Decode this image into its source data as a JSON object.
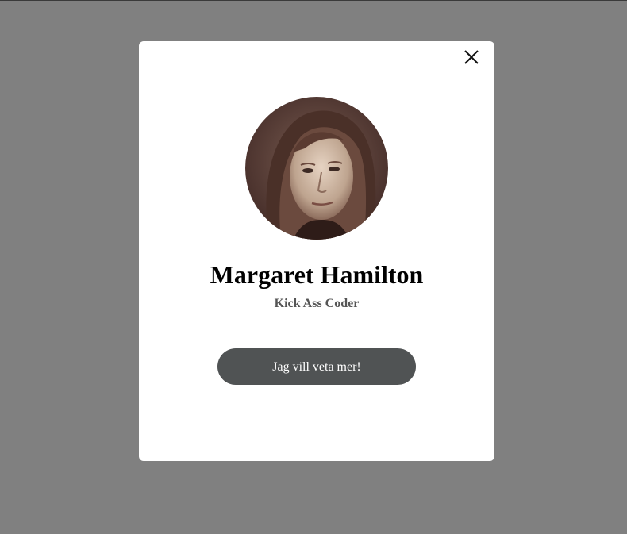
{
  "modal": {
    "close_icon": "close-icon",
    "avatar_icon": "portrait-photo",
    "name": "Margaret Hamilton",
    "subtitle": "Kick Ass Coder",
    "cta_label": "Jag vill veta mer!"
  },
  "colors": {
    "backdrop": "#808080",
    "modal_bg": "#ffffff",
    "button_bg": "#505354",
    "button_text": "#ffffff",
    "subtitle_text": "#555555"
  }
}
